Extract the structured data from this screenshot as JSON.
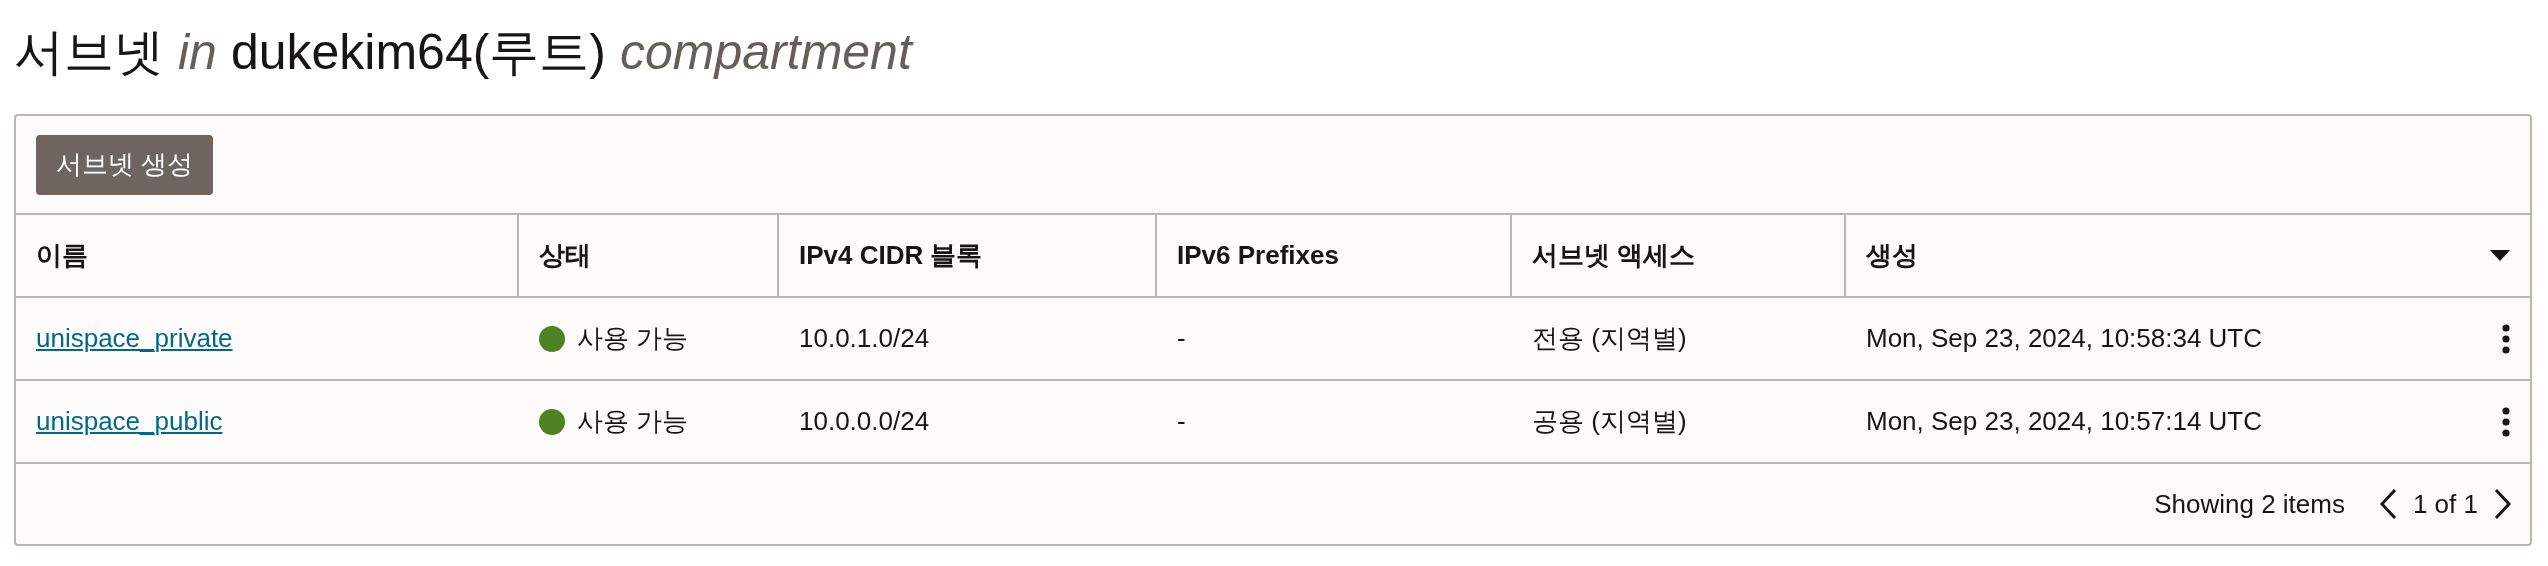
{
  "page_title": {
    "resource": "서브넷",
    "in": "in",
    "compartment_name": "dukekim64(루트)",
    "suffix": "compartment"
  },
  "create_button": "서브넷 생성",
  "table": {
    "columns": [
      "이름",
      "상태",
      "IPv4 CIDR 블록",
      "IPv6 Prefixes",
      "서브넷 액세스",
      "생성"
    ],
    "rows": [
      {
        "name": "unispace_private",
        "status": "사용 가능",
        "ipv4": "10.0.1.0/24",
        "ipv6": "-",
        "access": "전용 (지역별)",
        "created": "Mon, Sep 23, 2024, 10:58:34 UTC"
      },
      {
        "name": "unispace_public",
        "status": "사용 가능",
        "ipv4": "10.0.0.0/24",
        "ipv6": "-",
        "access": "공용 (지역별)",
        "created": "Mon, Sep 23, 2024, 10:57:14 UTC"
      }
    ]
  },
  "footer": {
    "count": "Showing 2 items",
    "page": "1 of 1"
  }
}
